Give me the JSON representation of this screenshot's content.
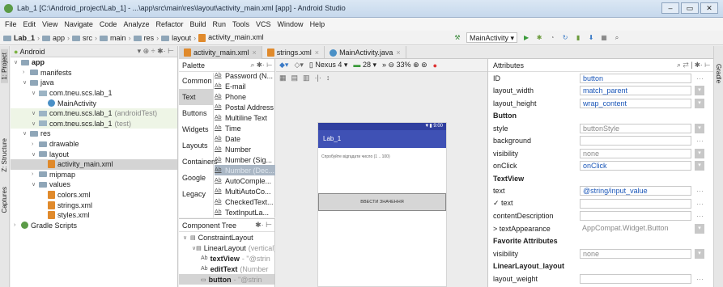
{
  "window": {
    "title": "Lab_1 [C:\\Android_project\\Lab_1] - ...\\app\\src\\main\\res\\layout\\activity_main.xml [app] - Android Studio",
    "controls": [
      "–",
      "▭",
      "✕"
    ]
  },
  "menu": [
    "File",
    "Edit",
    "View",
    "Navigate",
    "Code",
    "Analyze",
    "Refactor",
    "Build",
    "Run",
    "Tools",
    "VCS",
    "Window",
    "Help"
  ],
  "breadcrumb": [
    "Lab_1",
    "app",
    "src",
    "main",
    "res",
    "layout",
    "activity_main.xml"
  ],
  "run_config": "MainActivity",
  "project_panel": {
    "view_mode": "Android",
    "items": [
      {
        "label": "app",
        "kind": "folder",
        "depth": 0,
        "bold": true
      },
      {
        "label": "manifests",
        "kind": "folder",
        "depth": 1
      },
      {
        "label": "java",
        "kind": "folder",
        "depth": 1
      },
      {
        "label": "com.tneu.scs.lab_1",
        "kind": "pkg",
        "depth": 2,
        "suffix": ""
      },
      {
        "label": "MainActivity",
        "kind": "class",
        "depth": 3
      },
      {
        "label": "com.tneu.scs.lab_1",
        "kind": "pkg",
        "depth": 2,
        "suffix": "(androidTest)"
      },
      {
        "label": "com.tneu.scs.lab_1",
        "kind": "pkg",
        "depth": 2,
        "suffix": "(test)"
      },
      {
        "label": "res",
        "kind": "folder",
        "depth": 1
      },
      {
        "label": "drawable",
        "kind": "folder",
        "depth": 2
      },
      {
        "label": "layout",
        "kind": "folder",
        "depth": 2
      },
      {
        "label": "activity_main.xml",
        "kind": "xml",
        "depth": 3,
        "selected": true
      },
      {
        "label": "mipmap",
        "kind": "folder",
        "depth": 2
      },
      {
        "label": "values",
        "kind": "folder",
        "depth": 2
      },
      {
        "label": "colors.xml",
        "kind": "xml",
        "depth": 3
      },
      {
        "label": "strings.xml",
        "kind": "xml",
        "depth": 3
      },
      {
        "label": "styles.xml",
        "kind": "xml",
        "depth": 3
      },
      {
        "label": "Gradle Scripts",
        "kind": "gradle",
        "depth": 0
      }
    ]
  },
  "left_strip": [
    "1: Project",
    "Z: Structure",
    "Captures"
  ],
  "editor_tabs": [
    "activity_main.xml",
    "strings.xml",
    "MainActivity.java"
  ],
  "palette": {
    "title": "Palette",
    "categories": [
      "Common",
      "Text",
      "Buttons",
      "Widgets",
      "Layouts",
      "Containers",
      "Google",
      "Legacy"
    ],
    "items": [
      "Password (N...",
      "E-mail",
      "Phone",
      "Postal Address",
      "Multiline Text",
      "Time",
      "Date",
      "Number",
      "Number (Sig...",
      "Number (Dec...",
      "AutoComple...",
      "MultiAutoCo...",
      "CheckedText...",
      "TextInputLa..."
    ]
  },
  "component_tree": {
    "title": "Component Tree",
    "nodes": [
      {
        "label": "ConstraintLayout",
        "suffix": "",
        "depth": 0
      },
      {
        "label": "LinearLayout",
        "suffix": "(vertical)",
        "depth": 1
      },
      {
        "label": "textView",
        "suffix": "- \"@strin",
        "depth": 2,
        "bold": true,
        "prefix": "Ab"
      },
      {
        "label": "editText",
        "suffix": "(Number",
        "depth": 2,
        "bold": true,
        "prefix": "Ab"
      },
      {
        "label": "button",
        "suffix": "- \"@strin",
        "depth": 2,
        "bold": true,
        "prefix": "▭"
      }
    ]
  },
  "design_toolbar": {
    "device": "Nexus 4",
    "api": "28",
    "zoom": "33%"
  },
  "phone": {
    "status_time": "9:00",
    "app_title": "Lab_1",
    "hint_text": "Спробуйте відгадати число (1 .. 100)",
    "button_text": "ВВЕСТИ ЗНАЧЕННЯ"
  },
  "attributes": {
    "title": "Attributes",
    "rows": [
      {
        "name": "ID",
        "value": "button",
        "type": "text"
      },
      {
        "name": "layout_width",
        "value": "match_parent",
        "type": "combo"
      },
      {
        "name": "layout_height",
        "value": "wrap_content",
        "type": "combo"
      },
      {
        "name": "Button",
        "type": "header"
      },
      {
        "name": "style",
        "value": "buttonStyle",
        "type": "combo",
        "gray": true
      },
      {
        "name": "background",
        "value": "",
        "type": "text"
      },
      {
        "name": "visibility",
        "value": "none",
        "type": "combo",
        "gray": true
      },
      {
        "name": "onClick",
        "value": "onClick",
        "type": "combo"
      },
      {
        "name": "TextView",
        "type": "header"
      },
      {
        "name": "text",
        "value": "@string/input_value",
        "type": "text"
      },
      {
        "name": "✓ text",
        "value": "",
        "type": "text"
      },
      {
        "name": "contentDescription",
        "value": "",
        "type": "text"
      },
      {
        "name": "> textAppearance",
        "value": "AppCompat.Widget.Button",
        "type": "combo",
        "gray": true,
        "nobox": true
      },
      {
        "name": "Favorite Attributes",
        "type": "header"
      },
      {
        "name": "visibility",
        "value": "none",
        "type": "combo",
        "gray": true
      },
      {
        "name": "LinearLayout_layout",
        "type": "header"
      },
      {
        "name": "layout_weight",
        "value": "",
        "type": "text"
      }
    ]
  },
  "right_strip": [
    "Gradle"
  ],
  "colors": {
    "accent": "#3f51b5",
    "selection": "#d0d0d0",
    "link": "#1a56b8"
  }
}
